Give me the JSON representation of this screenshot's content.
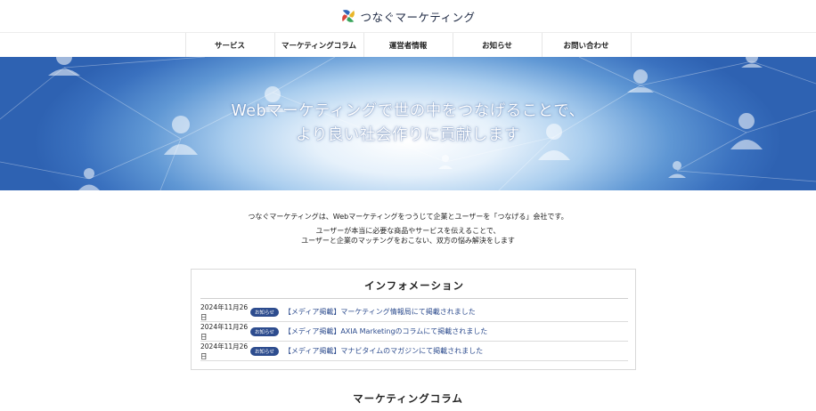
{
  "header": {
    "logo_text": "つなぐマーケティング",
    "logo_icon": "pinwheel-logo-icon"
  },
  "nav": {
    "items": [
      {
        "label": "サービス"
      },
      {
        "label": "マーケティングコラム"
      },
      {
        "label": "運営者情報"
      },
      {
        "label": "お知らせ"
      },
      {
        "label": "お問い合わせ"
      }
    ]
  },
  "hero": {
    "line1": "Webマーケティングで世の中をつなげることで、",
    "line2": "より良い社会作りに貢献します",
    "colors": {
      "light": "#ffffff",
      "dark": "#2e62b2"
    },
    "icons": "person-icon"
  },
  "intro": {
    "line1": "つなぐマーケティングは、Webマーケティングをつうじて企業とユーザーを「つなげる」会社です。",
    "line2": "ユーザーが本当に必要な商品やサービスを伝えることで、",
    "line3": "ユーザーと企業のマッチングをおこない、双方の悩み解決をします"
  },
  "information": {
    "title": "インフォメーション",
    "items": [
      {
        "date": "2024年11月26日",
        "badge": "お知らせ",
        "text": "【メディア掲載】マーケティング情報局にて掲載されました"
      },
      {
        "date": "2024年11月26日",
        "badge": "お知らせ",
        "text": "【メディア掲載】AXIA Marketingのコラムにて掲載されました"
      },
      {
        "date": "2024年11月26日",
        "badge": "お知らせ",
        "text": "【メディア掲載】マナビタイムのマガジンにて掲載されました"
      }
    ],
    "badge_color": "#2d4c8e",
    "link_color": "#2d4c8e"
  },
  "column_section": {
    "title": "マーケティングコラム"
  }
}
